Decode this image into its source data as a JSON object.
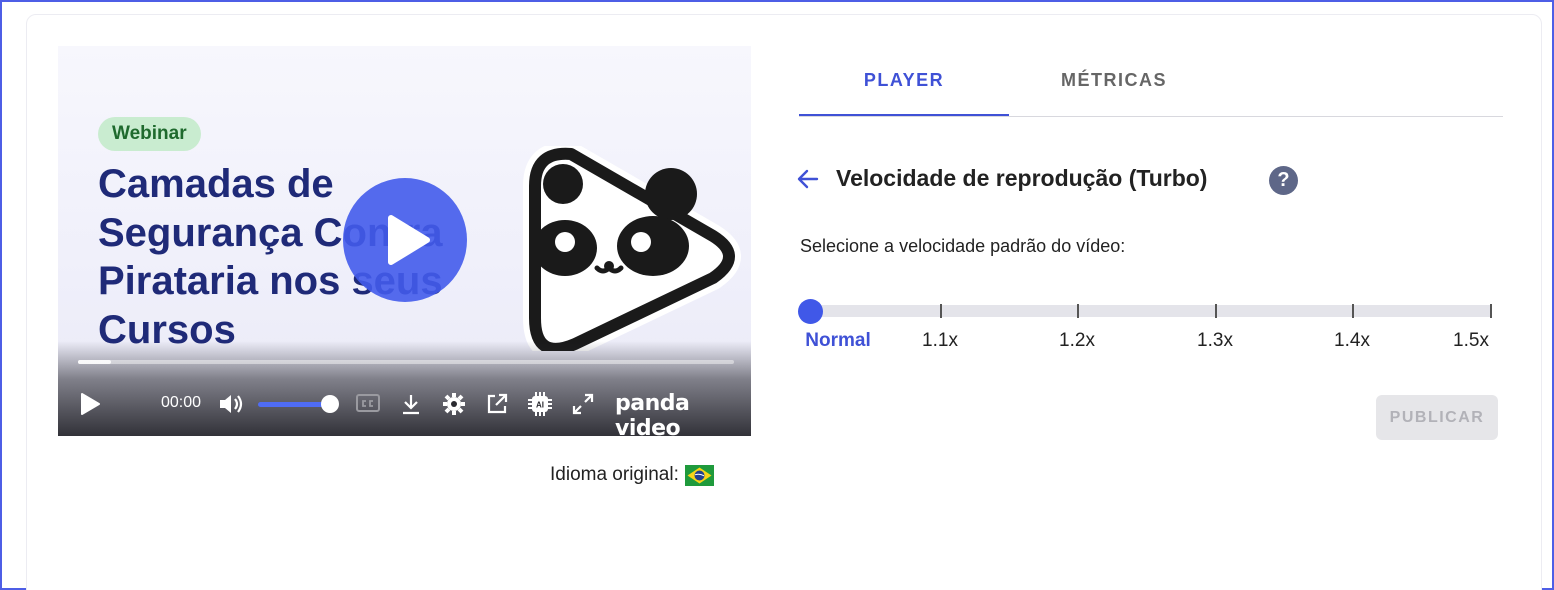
{
  "video": {
    "badge": "Webinar",
    "headline": "Camadas de Segurança Contra Pirataria nos seus Cursos",
    "time": "00:00",
    "brand": "panda video",
    "progress_fraction": 0.05,
    "volume_fraction": 0.87,
    "icons": [
      "play-icon",
      "volume-icon",
      "captions-icon",
      "download-icon",
      "settings-icon",
      "external-link-icon",
      "ai-chip-icon",
      "fullscreen-icon"
    ]
  },
  "language": {
    "label": "Idioma original:",
    "flag": "brazil-flag"
  },
  "tabs": [
    {
      "label": "PLAYER",
      "active": true
    },
    {
      "label": "MÉTRICAS",
      "active": false
    }
  ],
  "speed_section": {
    "title": "Velocidade de reprodução (Turbo)",
    "help": "?",
    "subtitle": "Selecione a velocidade padrão do vídeo:",
    "marks": [
      "Normal",
      "1.1x",
      "1.2x",
      "1.3x",
      "1.4x",
      "1.5x"
    ],
    "selected": "Normal"
  },
  "publish_label": "PUBLICAR",
  "colors": {
    "accent": "#3f51d6",
    "headline": "#1f2a78",
    "badge_bg": "#c9ecd0",
    "badge_text": "#1f6a2e",
    "disabled_button": "#e6e6e9"
  }
}
